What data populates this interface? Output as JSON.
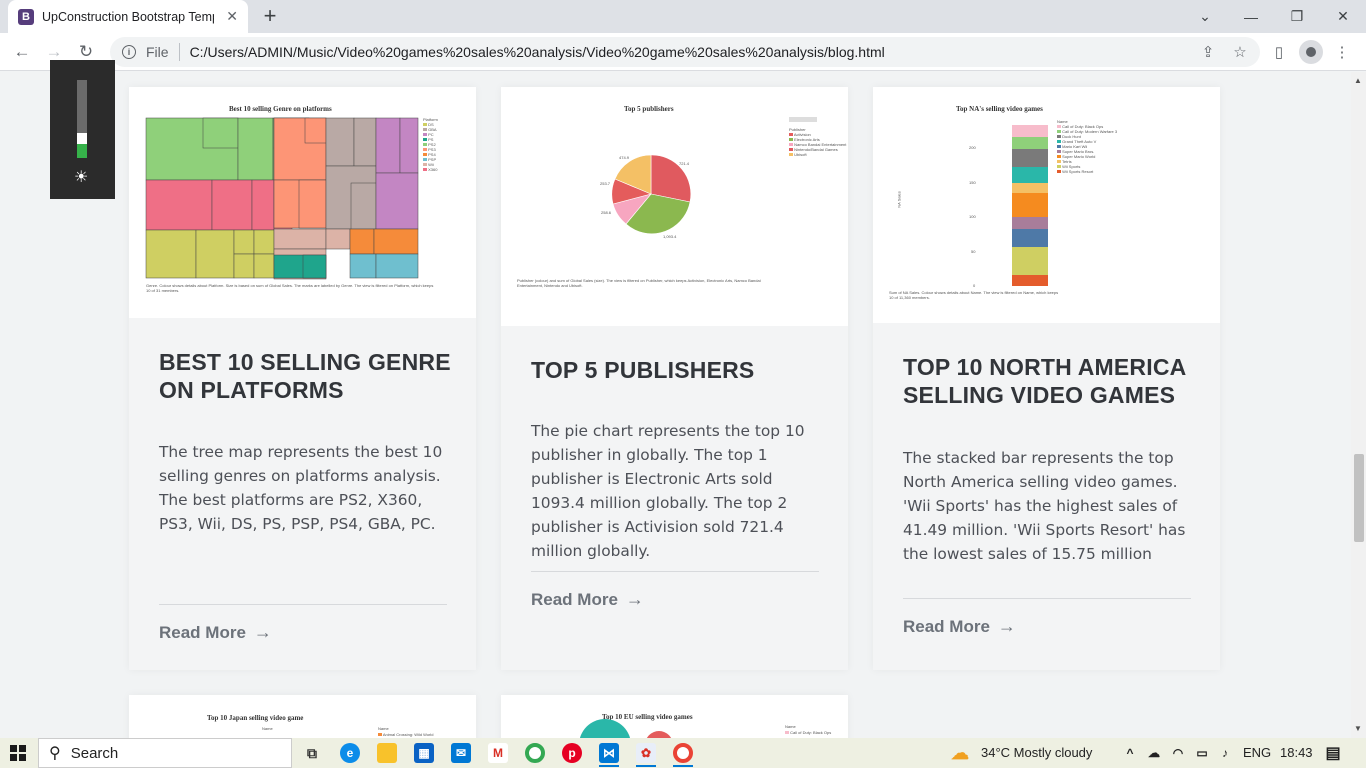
{
  "browser": {
    "tab_title": "UpConstruction Bootstrap Templ",
    "favicon_letter": "B",
    "scheme_label": "File",
    "url": "C:/Users/ADMIN/Music/Video%20games%20sales%20analysis/Video%20game%20sales%20analysis/blog.html"
  },
  "cards": [
    {
      "title": "BEST 10 SELLING GENRE ON PLATFORMS",
      "text": "The tree map represents the best 10 selling genres on platforms analysis. The best platforms are PS2, X360, PS3, Wii, DS, PS, PSP, PS4, GBA, PC.",
      "read_more": "Read More",
      "chart_title": "Best 10 selling Genre on platforms",
      "legend_title": "Platform",
      "legend": [
        "DS",
        "GBA",
        "PC",
        "PS",
        "PS2",
        "PS3",
        "PS4",
        "PSP",
        "Wii",
        "X360"
      ],
      "caption": "Genre. Colour shows details about Platform. Size is based on sum of Global Sales. The marks are labelled by Genre. The view is filtered on Platform, which keeps 10 of 31 members."
    },
    {
      "title": "TOP 5 PUBLISHERS",
      "text": "The pie chart represents the top 10 publisher in globally. The top 1 publisher is Electronic Arts sold 1093.4 million globally. The top 2 publisher is Activision sold 721.4 million globally.",
      "read_more": "Read More",
      "chart_title": "Top 5 publishers",
      "legend_title": "Publisher",
      "legend": [
        "Activision",
        "Electronic Arts",
        "Namco Bandai Entertainment",
        "Nintendo/Bandai Games",
        "Ubisoft"
      ],
      "pie_labels": [
        "721.4",
        "1,093.4",
        "258.6",
        "253.7",
        "474.9"
      ],
      "caption": "Publisher (colour) and sum of Global Sales (size). The view is filtered on Publisher, which keeps Activision, Electronic Arts, Namco Bandai Entertainment, Nintendo and Ubisoft."
    },
    {
      "title": "TOP 10 NORTH AMERICA SELLING VIDEO GAMES",
      "text": "The stacked bar represents the top North America selling video games. 'Wii Sports' has the highest sales of 41.49 million. 'Wii Sports Resort' has the lowest sales of 15.75 million",
      "read_more": "Read More",
      "chart_title": "Top NA's selling video games",
      "legend_title": "Name",
      "legend": [
        "Call of Duty: Black Ops",
        "Call of Duty: Modern Warfare 3",
        "Duck Hunt",
        "Grand Theft Auto V",
        "Mario Kart Wii",
        "Super Mario Bros.",
        "Super Mario World",
        "Tetris",
        "Wii Sports",
        "Wii Sports Resort"
      ],
      "y_ticks": [
        "200",
        "150",
        "100",
        "50",
        "0"
      ],
      "y_label": "NA Sales",
      "caption": "Sum of NA Sales. Colour shows details about Name. The view is filtered on Name, which keeps 10 of 11,360 members."
    },
    {
      "chart_title": "Top 10 Japan selling video game",
      "legend_title": "Name",
      "legend": [
        "Animal Crossing: Wild World"
      ]
    },
    {
      "chart_title": "Top 10 EU selling video  games",
      "legend_title": "Name",
      "legend": [
        "Call of Duty: Black Ops"
      ]
    }
  ],
  "taskbar": {
    "search_placeholder": "Search",
    "weather": "34°C  Mostly cloudy",
    "language": "ENG",
    "time": "18:43"
  }
}
